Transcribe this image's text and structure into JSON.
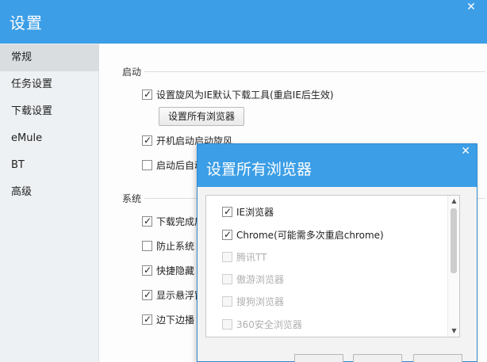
{
  "window": {
    "title": "设置",
    "close_glyph": "✕"
  },
  "sidebar": {
    "items": [
      {
        "label": "常规",
        "active": true
      },
      {
        "label": "任务设置",
        "active": false
      },
      {
        "label": "下载设置",
        "active": false
      },
      {
        "label": "eMule",
        "active": false
      },
      {
        "label": "BT",
        "active": false
      },
      {
        "label": "高级",
        "active": false
      }
    ]
  },
  "startup": {
    "heading": "启动",
    "opt_default_tool": {
      "label": "设置旋风为IE默认下载工具(重启IE后生效)",
      "checked": true
    },
    "set_all_browsers_button": "设置所有浏览器",
    "opt_autostart": {
      "label": "开机启动启动旋风",
      "checked": true
    },
    "opt_after_start": {
      "label": "启动后自动",
      "checked": false
    }
  },
  "system": {
    "heading": "系统",
    "options": [
      {
        "label": "下载完成后",
        "checked": true
      },
      {
        "label": "防止系统",
        "checked": false
      },
      {
        "label": "快捷隐藏",
        "checked": true
      },
      {
        "label": "显示悬浮窗",
        "checked": true
      },
      {
        "label": "边下边播",
        "checked": true
      }
    ]
  },
  "dialog": {
    "title": "设置所有浏览器",
    "close_glyph": "✕",
    "browsers": [
      {
        "label": "IE浏览器",
        "checked": true,
        "enabled": true
      },
      {
        "label": "Chrome(可能需多次重启chrome)",
        "checked": true,
        "enabled": true
      },
      {
        "label": "腾讯TT",
        "checked": false,
        "enabled": false
      },
      {
        "label": "傲游浏览器",
        "checked": false,
        "enabled": false
      },
      {
        "label": "搜狗浏览器",
        "checked": false,
        "enabled": false
      },
      {
        "label": "360安全浏览器",
        "checked": false,
        "enabled": false
      }
    ],
    "scroll_up_glyph": "▲",
    "scroll_down_glyph": "▼"
  },
  "colors": {
    "accent": "#3c9ee6",
    "sidebar_bg": "#eef1f3",
    "active_item_bg": "#d9dde0"
  }
}
